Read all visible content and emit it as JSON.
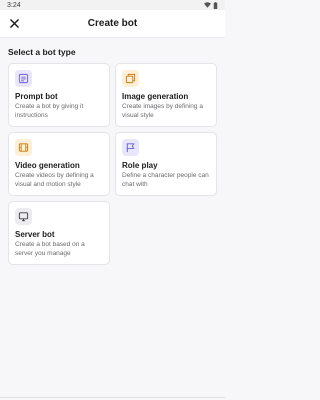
{
  "status_bar": {
    "time": "3:24"
  },
  "header": {
    "title": "Create bot"
  },
  "section": {
    "title": "Select a bot type"
  },
  "bot_types": [
    {
      "title": "Prompt bot",
      "description": "Create a bot by giving it instructions",
      "icon": "prompt-icon",
      "color": "#e8e6fb"
    },
    {
      "title": "Image generation",
      "description": "Create images by defining a visual style",
      "icon": "image-stack-icon",
      "color": "#fdeed6"
    },
    {
      "title": "Video generation",
      "description": "Create videos by defining a visual and motion style",
      "icon": "film-icon",
      "color": "#fdeed6"
    },
    {
      "title": "Role play",
      "description": "Define a character people can chat with",
      "icon": "flag-icon",
      "color": "#e8e6fb"
    },
    {
      "title": "Server bot",
      "description": "Create a bot based on a server you manage",
      "icon": "monitor-icon",
      "color": "#ececef"
    }
  ]
}
